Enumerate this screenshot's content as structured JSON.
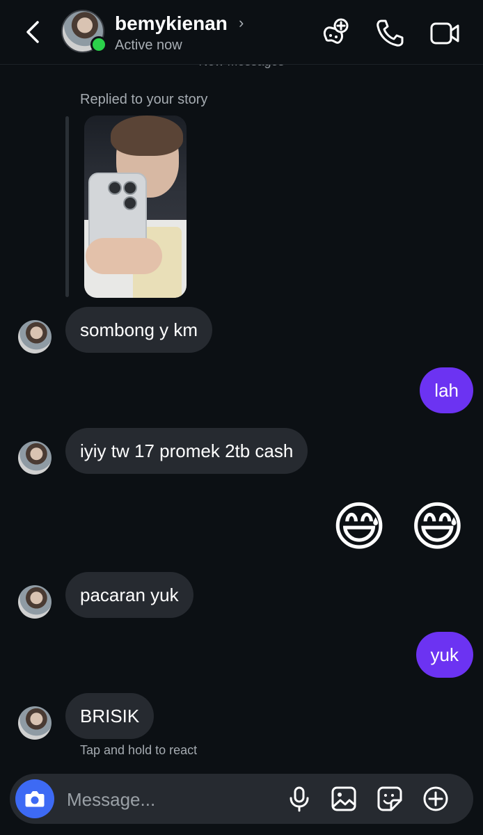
{
  "header": {
    "username": "bemykienan",
    "chevron": "›",
    "status": "Active now",
    "icons": [
      "back-chevron-icon",
      "game-controller-plus-icon",
      "phone-icon",
      "video-camera-icon"
    ]
  },
  "divider_text": "New Messages",
  "story_reply": {
    "label": "Replied to your story"
  },
  "messages": [
    {
      "from": "them",
      "text": "sombong y km"
    },
    {
      "from": "me",
      "text": "lah"
    },
    {
      "from": "them",
      "text": "iyiy tw 17 promek 2tb cash"
    },
    {
      "from": "me",
      "text": "😅 😅"
    },
    {
      "from": "them",
      "text": "pacaran yuk"
    },
    {
      "from": "me",
      "text": "yuk"
    },
    {
      "from": "them",
      "text": "BRISIK"
    }
  ],
  "hint": "Tap and hold to react",
  "composer": {
    "placeholder": "Message...",
    "icons": [
      "camera-icon",
      "microphone-icon",
      "gallery-icon",
      "sticker-icon",
      "plus-circle-icon"
    ]
  },
  "colors": {
    "background": "#0c1014",
    "incoming_bubble": "#262a30",
    "outgoing_bubble": "#6c33f2",
    "camera_button": "#3d6af4",
    "online": "#2bd14a"
  }
}
